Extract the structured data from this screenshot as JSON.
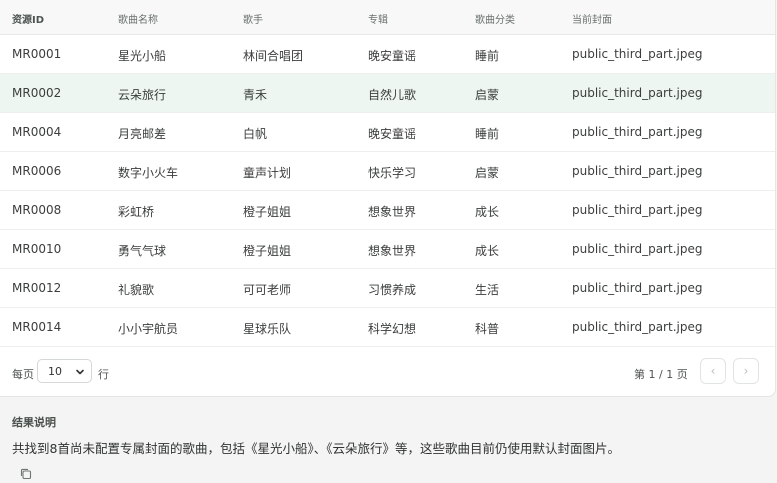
{
  "table": {
    "headers": [
      "资源ID",
      "歌曲名称",
      "歌手",
      "专辑",
      "歌曲分类",
      "当前封面"
    ],
    "rows": [
      [
        "MR0001",
        "星光小船",
        "林间合唱团",
        "晚安童谣",
        "睡前",
        "public_third_part.jpeg"
      ],
      [
        "MR0002",
        "云朵旅行",
        "青禾",
        "自然儿歌",
        "启蒙",
        "public_third_part.jpeg"
      ],
      [
        "MR0004",
        "月亮邮差",
        "白帆",
        "晚安童谣",
        "睡前",
        "public_third_part.jpeg"
      ],
      [
        "MR0006",
        "数字小火车",
        "童声计划",
        "快乐学习",
        "启蒙",
        "public_third_part.jpeg"
      ],
      [
        "MR0008",
        "彩虹桥",
        "橙子姐姐",
        "想象世界",
        "成长",
        "public_third_part.jpeg"
      ],
      [
        "MR0010",
        "勇气气球",
        "橙子姐姐",
        "想象世界",
        "成长",
        "public_third_part.jpeg"
      ],
      [
        "MR0012",
        "礼貌歌",
        "可可老师",
        "习惯养成",
        "生活",
        "public_third_part.jpeg"
      ],
      [
        "MR0014",
        "小小宇航员",
        "星球乐队",
        "科学幻想",
        "科普",
        "public_third_part.jpeg"
      ]
    ]
  },
  "pagination": {
    "per_page_label": "每页",
    "per_page_value": "10",
    "per_page_suffix": "行",
    "page_info": "第 1 / 1 页",
    "prev_label": "‹",
    "next_label": "›"
  },
  "result": {
    "title": "结果说明",
    "description": "共找到8首尚未配置专属封面的歌曲，包括《星光小船》、《云朵旅行》等，这些歌曲目前仍使用默认封面图片。"
  }
}
